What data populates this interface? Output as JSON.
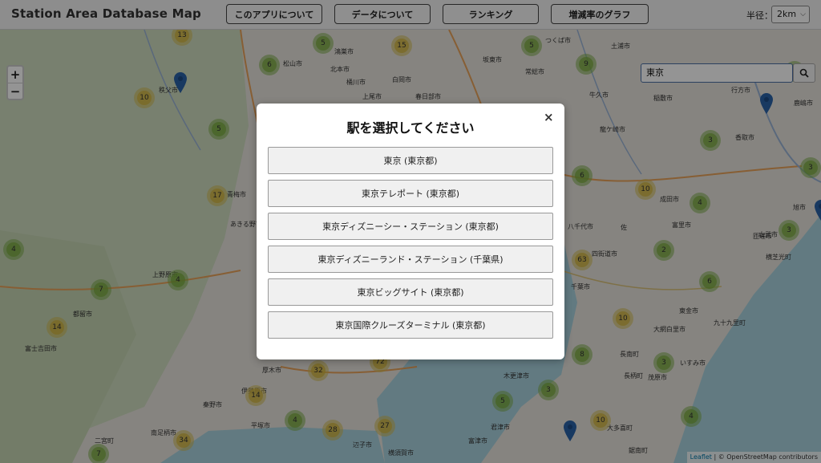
{
  "header": {
    "title": "Station Area Database Map",
    "nav": [
      "このアプリについて",
      "データについて",
      "ランキング",
      "増減率のグラフ"
    ],
    "radius_label": "半径：",
    "radius_value": "2km"
  },
  "map": {
    "zoom_in": "+",
    "zoom_out": "−",
    "search_value": "東京",
    "attribution_leaflet": "Leaflet",
    "attribution_rest": " | © OpenStreetMap contributors",
    "clusters": [
      "13",
      "5",
      "15",
      "5",
      "6",
      "9",
      "10",
      "5",
      "6",
      "3",
      "3",
      "17",
      "10",
      "4",
      "6",
      "3",
      "4",
      "63",
      "2",
      "7",
      "4",
      "6",
      "14",
      "10",
      "8",
      "3",
      "72",
      "32",
      "3",
      "14",
      "5",
      "4",
      "28",
      "27",
      "10",
      "34",
      "4",
      "7"
    ],
    "places": [
      "秩父市",
      "松山市",
      "鴻巣市",
      "北本市",
      "桶川市",
      "上尾市",
      "白岡市",
      "春日部市",
      "坂東市",
      "つくば市",
      "土浦市",
      "常総市",
      "牛久市",
      "稲敷市",
      "行方市",
      "鹿嶋市",
      "龍ケ崎市",
      "香取市",
      "青梅市",
      "あきる野市",
      "成田市",
      "富里市",
      "八千代市",
      "佐",
      "四街道市",
      "千葉市",
      "上野原市",
      "都留市",
      "富士吉田市",
      "厚木市",
      "伊勢原市",
      "平塚市",
      "秦野市",
      "南足柄市",
      "二宮町",
      "辺子市",
      "横須賀市",
      "木更津市",
      "君津市",
      "富津市",
      "鋸南町",
      "茂原市",
      "大網白里市",
      "東金市",
      "長柄町",
      "いすみ市",
      "長南町",
      "九十九里町",
      "大多喜町",
      "匝瑳市",
      "旭市",
      "横芝光町",
      "山武市"
    ]
  },
  "modal": {
    "title": "駅を選択してください",
    "close": "×",
    "stations": [
      "東京 (東京都)",
      "東京テレポート (東京都)",
      "東京ディズニーシー・ステーション (東京都)",
      "東京ディズニーランド・ステーション (千葉県)",
      "東京ビッグサイト (東京都)",
      "東京国際クルーズターミナル (東京都)"
    ]
  },
  "colors": {
    "cluster_green": "#7eae48",
    "cluster_yellow": "#d6be50",
    "pin": "#2a62a8",
    "water": "#aad3df",
    "land": "#e6e3dc"
  },
  "icons": [
    "search-icon",
    "close-icon",
    "map-pin-icon",
    "zoom-in-icon",
    "zoom-out-icon",
    "chevron-down-icon"
  ]
}
